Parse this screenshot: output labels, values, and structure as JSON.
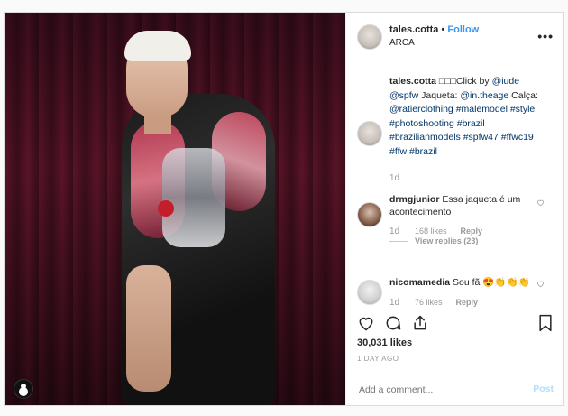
{
  "post": {
    "username": "tales.cotta",
    "follow_sep": " • ",
    "follow_label": "Follow",
    "location": "ARCA",
    "more_label": "•••",
    "caption": {
      "username": "tales.cotta",
      "text_before": " □□□Click by ",
      "parts": [
        {
          "t": "@iude",
          "link": true
        },
        {
          "t": " ",
          "link": false
        },
        {
          "t": "@spfw",
          "link": true
        },
        {
          "t": " Jaqueta: ",
          "link": false
        },
        {
          "t": "@in.theage",
          "link": true
        },
        {
          "t": " Calça: ",
          "link": false
        },
        {
          "t": "@ratierclothing",
          "link": true
        },
        {
          "t": " ",
          "link": false
        },
        {
          "t": "#malemodel",
          "link": true
        },
        {
          "t": " ",
          "link": false
        },
        {
          "t": "#style",
          "link": true
        },
        {
          "t": " ",
          "link": false
        },
        {
          "t": "#photoshooting",
          "link": true
        },
        {
          "t": " ",
          "link": false
        },
        {
          "t": "#brazil",
          "link": true
        },
        {
          "t": " ",
          "link": false
        },
        {
          "t": "#brazilianmodels",
          "link": true
        },
        {
          "t": " ",
          "link": false
        },
        {
          "t": "#spfw47",
          "link": true
        },
        {
          "t": " ",
          "link": false
        },
        {
          "t": "#ffwc19",
          "link": true
        },
        {
          "t": " ",
          "link": false
        },
        {
          "t": "#ffw",
          "link": true
        },
        {
          "t": " ",
          "link": false
        },
        {
          "t": "#brazil",
          "link": true
        }
      ],
      "time": "1d"
    },
    "comments": [
      {
        "username": "drmgjunior",
        "text": " Essa jaqueta é um acontecimento",
        "time": "1d",
        "likes": "168 likes",
        "reply": "Reply",
        "view_replies": "View replies (23)"
      },
      {
        "username": "nicomamedia",
        "text": " Sou fã 😍👏👏👏",
        "time": "1d",
        "likes": "76 likes",
        "reply": "Reply"
      }
    ],
    "like_count": "30,031 likes",
    "posted_ago": "1 DAY AGO",
    "add_comment_placeholder": "Add a comment...",
    "post_button": "Post",
    "icons": [
      "heart-icon",
      "comment-icon",
      "share-icon",
      "bookmark-icon",
      "tagged-user-icon",
      "more-options-icon"
    ]
  }
}
